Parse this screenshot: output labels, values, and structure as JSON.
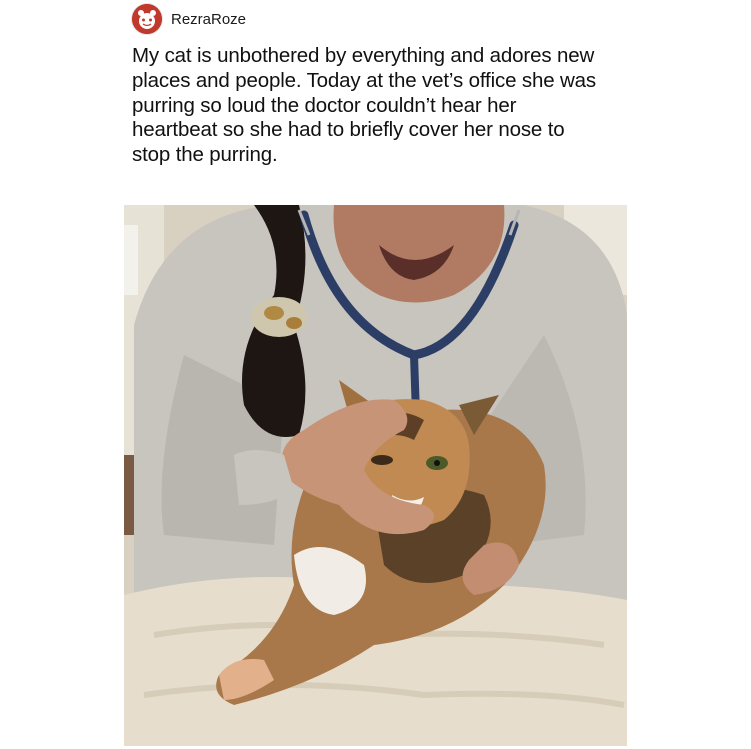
{
  "post": {
    "username": "RezraRoze",
    "avatar_icon": "reddit-style-avatar-icon",
    "text": "My cat is unbothered by everything and adores new places and people. Today at the vet’s office she was purring so loud the doctor couldn’t hear her heartbeat so she had to briefly cover her nose to stop the purring."
  },
  "colors": {
    "avatar_bg": "#c0392b",
    "sweatshirt": "#c9c6c1",
    "towel": "#e6ddcc",
    "stethoscope": "#2c3e66"
  }
}
